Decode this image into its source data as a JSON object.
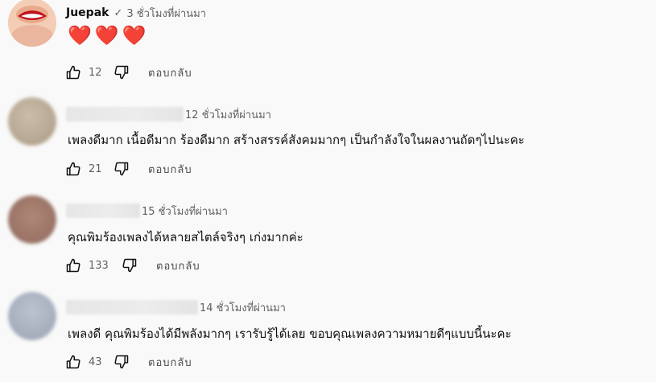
{
  "comments": [
    {
      "author": "Juepak",
      "time": "3 ชั่วโมงที่ผ่านมา",
      "text": "❤️❤️❤️",
      "likes": "12",
      "reply": "ตอบกลับ",
      "avatar_color": "#f2c3a9"
    },
    {
      "time": "12 ชั่วโมงที่ผ่านมา",
      "text": "เพลงดีมาก เนื้อดีมาก ร้องดีมาก สร้างสรรค์สังคมมากๆ เป็นกำลังใจในผลงานถัดๆไปนะคะ",
      "likes": "21",
      "reply": "ตอบกลับ",
      "avatar_color": "#bcae9a"
    },
    {
      "time": "15 ชั่วโมงที่ผ่านมา",
      "text": "คุณพิมร้องเพลงได้หลายสไตล์จริงๆ เก่งมากค่ะ",
      "likes": "133",
      "reply": "ตอบกลับ",
      "avatar_color": "#a57d72"
    },
    {
      "time": "14 ชั่วโมงที่ผ่านมา",
      "text": "เพลงดี คุณพิมร้องได้มีพลังมากๆ เรารับรู้ได้เลย ขอบคุณเพลงความหมายดีๆแบบนี้นะคะ",
      "likes": "43",
      "reply": "ตอบกลับ",
      "avatar_color": "#aeb6c4"
    }
  ]
}
